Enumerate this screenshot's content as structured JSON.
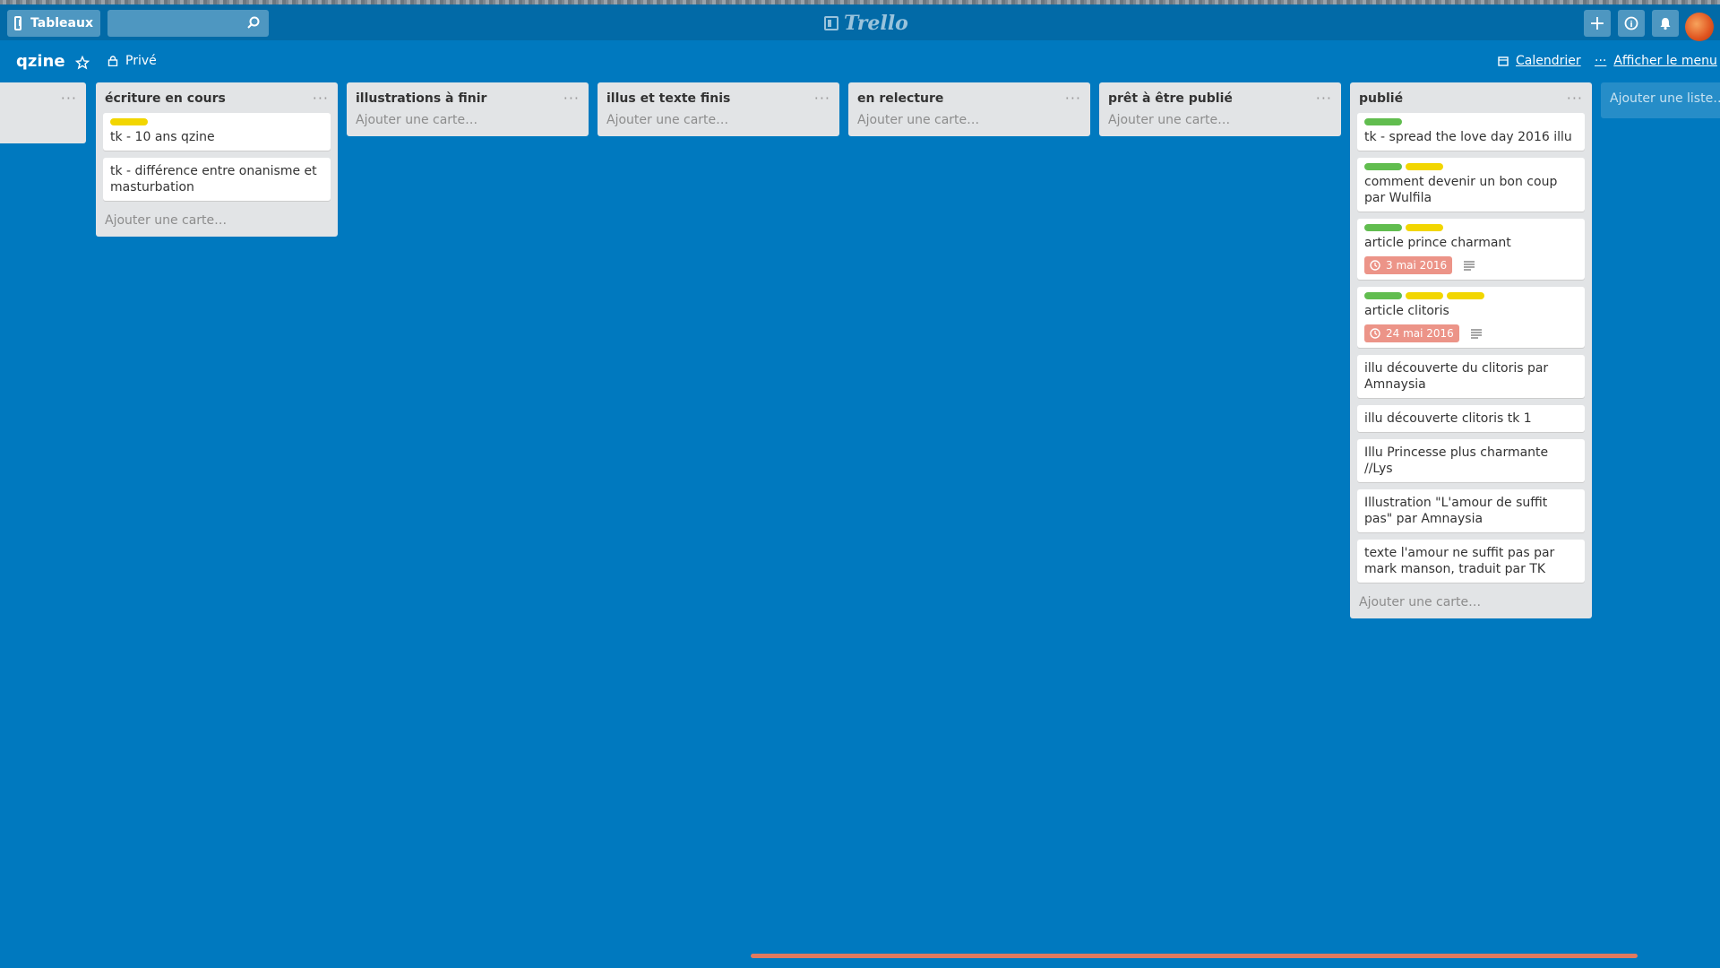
{
  "header": {
    "boards_label": "Tableaux",
    "search_placeholder": "",
    "logo_text": "Trello",
    "add_label": "+",
    "info_label": "i"
  },
  "board": {
    "title": "qzine",
    "privacy": "Privé",
    "calendar": "Calendrier",
    "menu": "Afficher le menu",
    "add_list": "Ajouter une liste…"
  },
  "lists": [
    {
      "title": "écriture en cours",
      "menu": "···",
      "cards": [
        {
          "labels": [
            "yellow"
          ],
          "title": "tk - 10 ans qzine"
        },
        {
          "labels": [],
          "title": "tk - différence entre onanisme et masturbation"
        }
      ],
      "add_card": "Ajouter une carte…"
    },
    {
      "title": "illustrations à finir",
      "menu": "···",
      "cards": [],
      "add_card": "Ajouter une carte…"
    },
    {
      "title": "illus et texte finis",
      "menu": "···",
      "cards": [],
      "add_card": "Ajouter une carte…"
    },
    {
      "title": "en relecture",
      "menu": "···",
      "cards": [],
      "add_card": "Ajouter une carte…"
    },
    {
      "title": "prêt à être publié",
      "menu": "···",
      "cards": [],
      "add_card": "Ajouter une carte…"
    },
    {
      "title": "publié",
      "menu": "···",
      "cards": [
        {
          "labels": [
            "green"
          ],
          "title": "tk - spread the love day 2016 illu"
        },
        {
          "labels": [
            "green",
            "yellow"
          ],
          "title": "comment devenir un bon coup par Wulfila"
        },
        {
          "labels": [
            "green",
            "yellow"
          ],
          "title": "article prince charmant",
          "due": "3 mai 2016",
          "has_description": true
        },
        {
          "labels": [
            "green",
            "yellow",
            "yellow"
          ],
          "title": "article clitoris",
          "due": "24 mai 2016",
          "has_description": true
        },
        {
          "labels": [],
          "title": "illu découverte du clitoris par Amnaysia"
        },
        {
          "labels": [],
          "title": "illu découverte clitoris tk 1"
        },
        {
          "labels": [],
          "title": "Illu Princesse plus charmante //Lys"
        },
        {
          "labels": [],
          "title": "Illustration \"L'amour de suffit pas\" par Amnaysia"
        },
        {
          "labels": [],
          "title": "texte l'amour ne suffit pas par mark manson, traduit par TK"
        }
      ],
      "add_card": "Ajouter une carte…"
    }
  ],
  "partial_list": {
    "menu": "···"
  },
  "colors": {
    "background": "#0079bf",
    "header": "#026aa7",
    "green": "#61bd4f",
    "yellow": "#f2d600",
    "due": "#ec9488",
    "scrollbar": "#e07a5f"
  }
}
